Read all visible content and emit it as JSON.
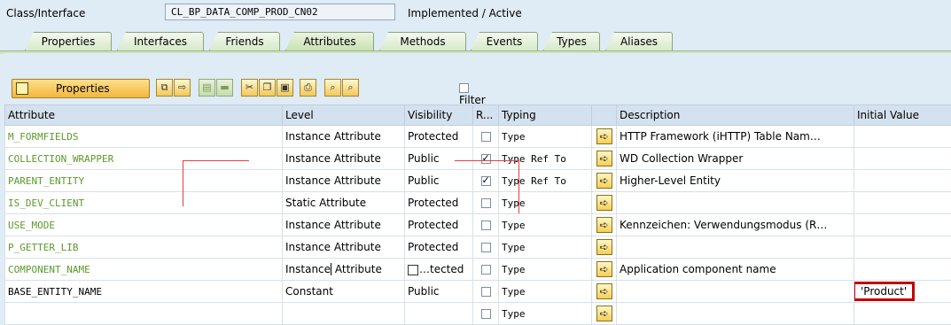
{
  "header": {
    "class_label": "Class/Interface",
    "class_value": "CL_BP_DATA_COMP_PROD_CN02",
    "status": "Implemented / Active"
  },
  "tabs": [
    {
      "label": "Properties",
      "active": false
    },
    {
      "label": "Interfaces",
      "active": false
    },
    {
      "label": "Friends",
      "active": false
    },
    {
      "label": "Attributes",
      "active": true
    },
    {
      "label": "Methods",
      "active": false
    },
    {
      "label": "Events",
      "active": false
    },
    {
      "label": "Types",
      "active": false
    },
    {
      "label": "Aliases",
      "active": false
    }
  ],
  "toolbar": {
    "properties_label": "Properties",
    "filter_label": "Filter",
    "icons": [
      "copy-icon",
      "paste-icon",
      "insert-row-icon",
      "delete-row-icon",
      "cut-icon",
      "copy-clipboard-icon",
      "paste-clipboard-icon",
      "print-icon",
      "find-icon",
      "find-next-icon"
    ]
  },
  "grid": {
    "columns": [
      "Attribute",
      "Level",
      "Visibility",
      "R...",
      "Typing",
      "",
      "Description",
      "Initial Value"
    ],
    "rows": [
      {
        "attribute": "M_FORMFIELDS",
        "level": "Instance Attribute",
        "visibility": "Protected",
        "readonly": false,
        "typing": "Type",
        "description": "HTTP Framework (iHTTP) Table Nam…",
        "initial": ""
      },
      {
        "attribute": "COLLECTION_WRAPPER",
        "level": "Instance Attribute",
        "visibility": "Public",
        "readonly": true,
        "typing": "Type Ref To",
        "description": "WD Collection Wrapper",
        "initial": ""
      },
      {
        "attribute": "PARENT_ENTITY",
        "level": "Instance Attribute",
        "visibility": "Public",
        "readonly": true,
        "typing": "Type Ref To",
        "description": "Higher-Level Entity",
        "initial": ""
      },
      {
        "attribute": "IS_DEV_CLIENT",
        "level": "Static Attribute",
        "visibility": "Protected",
        "readonly": false,
        "typing": "Type",
        "description": "",
        "initial": ""
      },
      {
        "attribute": "USE_MODE",
        "level": "Instance Attribute",
        "visibility": "Protected",
        "readonly": false,
        "typing": "Type",
        "description": "Kennzeichen: Verwendungsmodus (R…",
        "initial": ""
      },
      {
        "attribute": "P_GETTER_LIB",
        "level": "Instance Attribute",
        "visibility": "Protected",
        "readonly": false,
        "typing": "Type",
        "description": "",
        "initial": ""
      },
      {
        "attribute": "COMPONENT_NAME",
        "level": "Instance Attribute",
        "visibility": "…tected",
        "readonly": false,
        "typing": "Type",
        "description": "Application component name",
        "initial": ""
      },
      {
        "attribute": "BASE_ENTITY_NAME",
        "level": "Constant",
        "visibility": "Public",
        "readonly": false,
        "typing": "Type",
        "description": "",
        "initial": "'Product'"
      },
      {
        "attribute": "",
        "level": "",
        "visibility": "",
        "readonly": false,
        "typing": "Type",
        "description": "",
        "initial": ""
      }
    ]
  },
  "colors": {
    "attribute_text": "#5a9a2a",
    "highlight": "#c00000",
    "tab_green": "#d7e9c9"
  }
}
